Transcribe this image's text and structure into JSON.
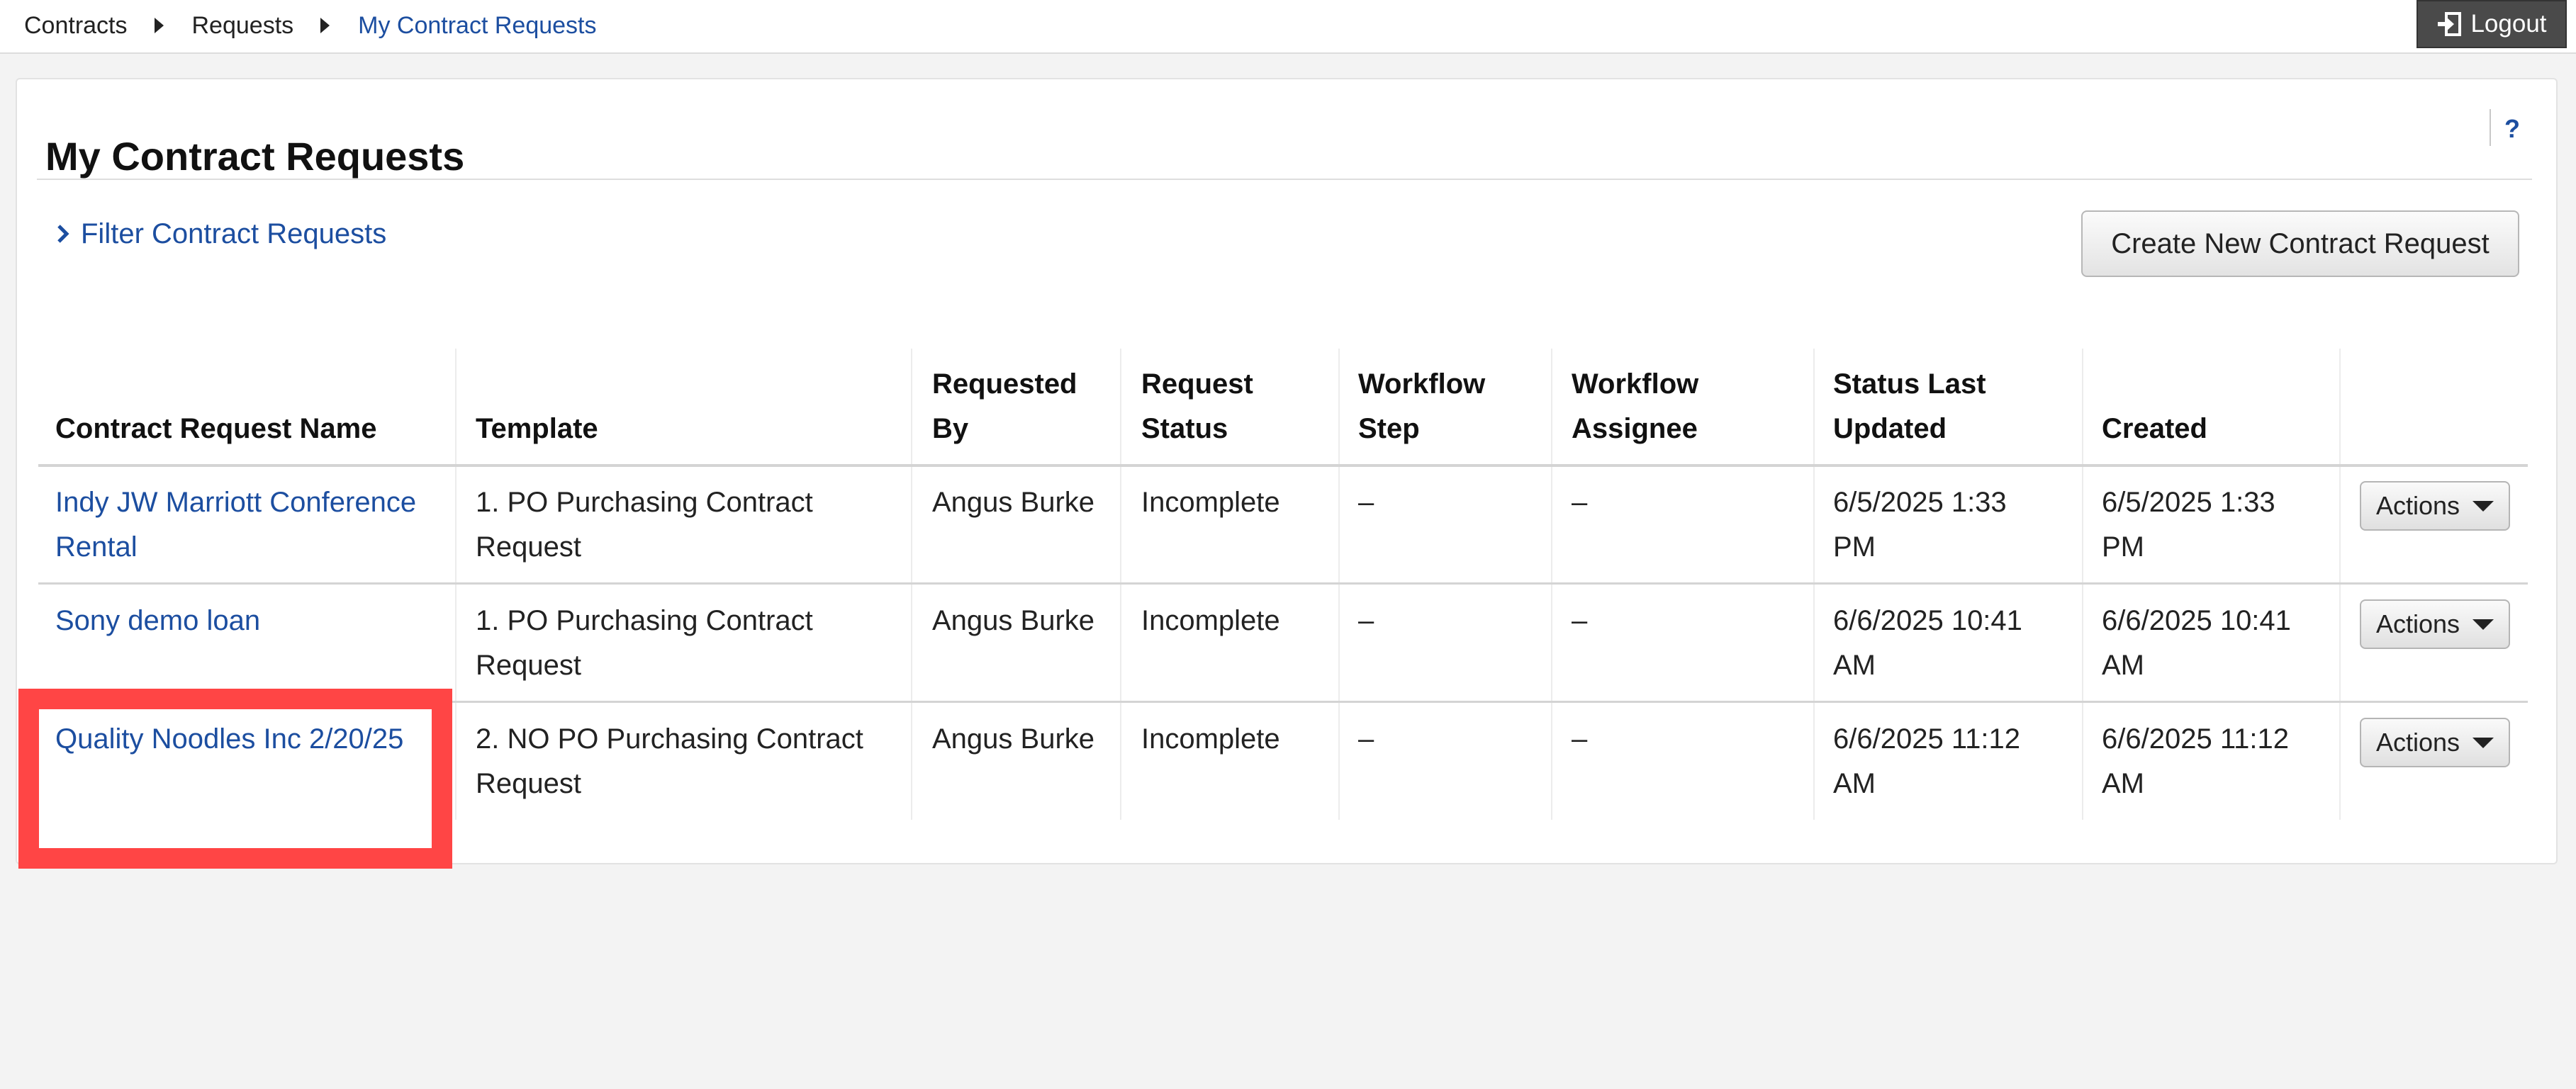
{
  "breadcrumb": [
    "Contracts",
    "Requests",
    "My Contract Requests"
  ],
  "logout_label": "Logout",
  "page_title": "My Contract Requests",
  "help_label": "?",
  "filter_label": "Filter Contract Requests",
  "create_button_label": "Create New Contract Request",
  "table": {
    "headers": [
      [
        "Contract Request Name"
      ],
      [
        "Template"
      ],
      [
        "Requested",
        "By"
      ],
      [
        "Request",
        "Status"
      ],
      [
        "Workflow",
        "Step"
      ],
      [
        "Workflow",
        "Assignee"
      ],
      [
        "Status Last",
        "Updated"
      ],
      [
        "Created"
      ]
    ],
    "rows": [
      {
        "name": [
          "Indy JW Marriott Conference",
          "Rental"
        ],
        "template": [
          "1. PO Purchasing Contract",
          "Request"
        ],
        "requested_by": "Angus Burke",
        "status": "Incomplete",
        "step": "–",
        "assignee": "–",
        "updated": [
          "6/5/2025 1:33",
          "PM"
        ],
        "created": [
          "6/5/2025 1:33",
          "PM"
        ],
        "actions_label": "Actions"
      },
      {
        "name": [
          "Sony demo loan"
        ],
        "template": [
          "1. PO Purchasing Contract",
          "Request"
        ],
        "requested_by": "Angus Burke",
        "status": "Incomplete",
        "step": "–",
        "assignee": "–",
        "updated": [
          "6/6/2025 10:41",
          "AM"
        ],
        "created": [
          "6/6/2025 10:41",
          "AM"
        ],
        "actions_label": "Actions"
      },
      {
        "name": [
          "Quality Noodles Inc 2/20/25"
        ],
        "template": [
          "2. NO PO Purchasing Contract",
          "Request"
        ],
        "requested_by": "Angus Burke",
        "status": "Incomplete",
        "step": "–",
        "assignee": "–",
        "updated": [
          "6/6/2025 11:12",
          "AM"
        ],
        "created": [
          "6/6/2025 11:12",
          "AM"
        ],
        "actions_label": "Actions"
      }
    ]
  },
  "colors": {
    "link": "#1c4ea0",
    "highlight": "#ff4545",
    "logout_bg": "#4a4a4a"
  }
}
